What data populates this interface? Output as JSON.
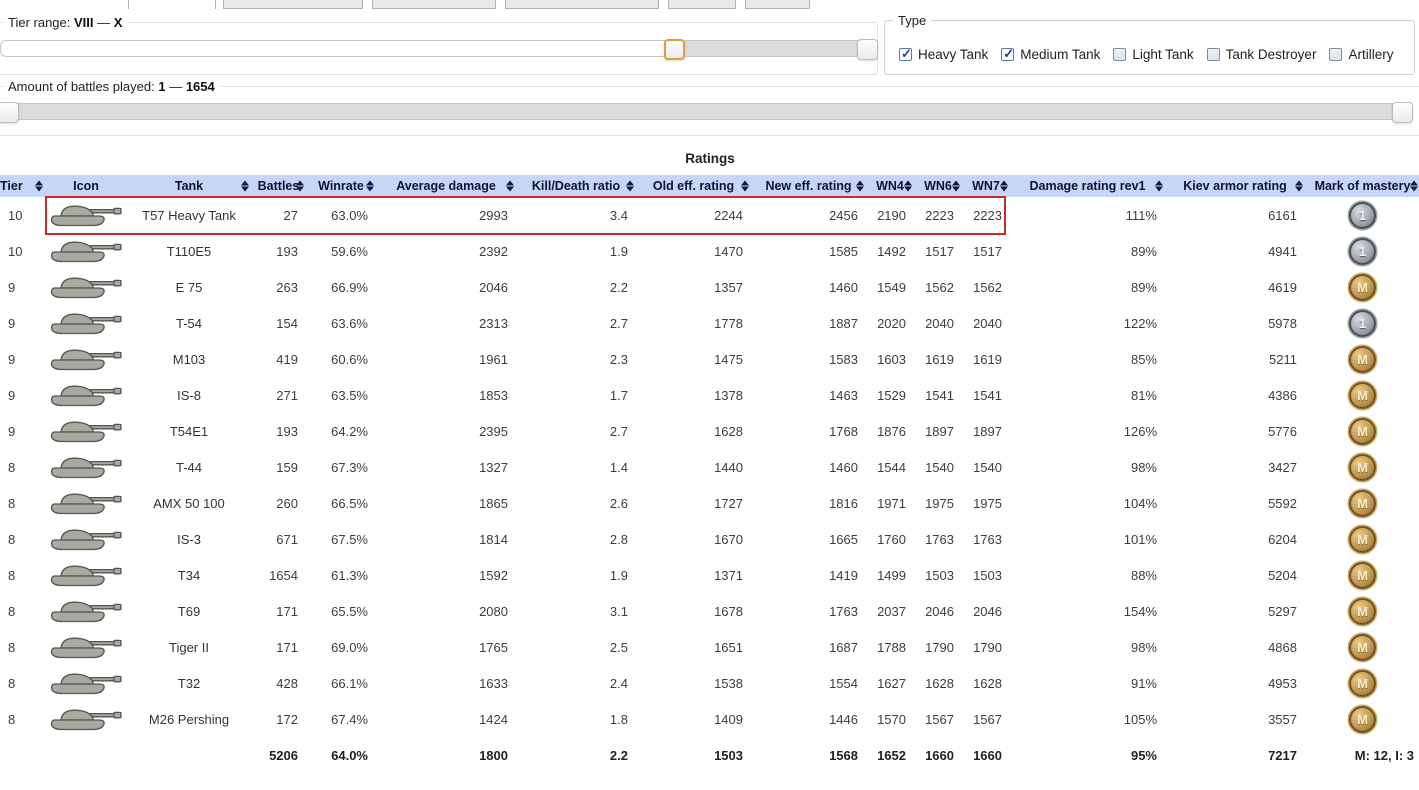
{
  "filters": {
    "tier_range": {
      "label": "Tier range:",
      "from": "VIII",
      "dash": "—",
      "to": "X"
    },
    "battles_range": {
      "label": "Amount of battles played:",
      "from": "1",
      "dash": "—",
      "to": "1654"
    },
    "type": {
      "legend": "Type",
      "options": [
        {
          "label": "Heavy Tank",
          "checked": true
        },
        {
          "label": "Medium Tank",
          "checked": true
        },
        {
          "label": "Light Tank",
          "checked": false
        },
        {
          "label": "Tank Destroyer",
          "checked": false
        },
        {
          "label": "Artillery",
          "checked": false
        }
      ]
    }
  },
  "table": {
    "title": "Ratings",
    "columns": [
      {
        "label": "Tier",
        "sortable": true
      },
      {
        "label": "Icon",
        "sortable": false
      },
      {
        "label": "Tank",
        "sortable": true
      },
      {
        "label": "Battles",
        "sortable": true
      },
      {
        "label": "Winrate",
        "sortable": true
      },
      {
        "label": "Average damage",
        "sortable": true
      },
      {
        "label": "Kill/Death ratio",
        "sortable": true
      },
      {
        "label": "Old eff. rating",
        "sortable": true
      },
      {
        "label": "New eff. rating",
        "sortable": true
      },
      {
        "label": "WN4",
        "sortable": true
      },
      {
        "label": "WN6",
        "sortable": true
      },
      {
        "label": "WN7",
        "sortable": true
      },
      {
        "label": "Damage rating rev1",
        "sortable": true
      },
      {
        "label": "Kiev armor rating",
        "sortable": true
      },
      {
        "label": "Mark of mastery",
        "sortable": true
      }
    ],
    "rows": [
      {
        "tier": "10",
        "tank": "T57 Heavy Tank",
        "battles": "27",
        "winrate": "63.0%",
        "avg_damage": "2993",
        "kd": "3.4",
        "old_eff": "2244",
        "new_eff": "2456",
        "wn4": "2190",
        "wn6": "2223",
        "wn7": "2223",
        "dmg_rev1": "111%",
        "kiev": "6161",
        "mastery": "1",
        "highlighted": true
      },
      {
        "tier": "10",
        "tank": "T110E5",
        "battles": "193",
        "winrate": "59.6%",
        "avg_damage": "2392",
        "kd": "1.9",
        "old_eff": "1470",
        "new_eff": "1585",
        "wn4": "1492",
        "wn6": "1517",
        "wn7": "1517",
        "dmg_rev1": "89%",
        "kiev": "4941",
        "mastery": "1"
      },
      {
        "tier": "9",
        "tank": "E 75",
        "battles": "263",
        "winrate": "66.9%",
        "avg_damage": "2046",
        "kd": "2.2",
        "old_eff": "1357",
        "new_eff": "1460",
        "wn4": "1549",
        "wn6": "1562",
        "wn7": "1562",
        "dmg_rev1": "89%",
        "kiev": "4619",
        "mastery": "M"
      },
      {
        "tier": "9",
        "tank": "T-54",
        "battles": "154",
        "winrate": "63.6%",
        "avg_damage": "2313",
        "kd": "2.7",
        "old_eff": "1778",
        "new_eff": "1887",
        "wn4": "2020",
        "wn6": "2040",
        "wn7": "2040",
        "dmg_rev1": "122%",
        "kiev": "5978",
        "mastery": "1"
      },
      {
        "tier": "9",
        "tank": "M103",
        "battles": "419",
        "winrate": "60.6%",
        "avg_damage": "1961",
        "kd": "2.3",
        "old_eff": "1475",
        "new_eff": "1583",
        "wn4": "1603",
        "wn6": "1619",
        "wn7": "1619",
        "dmg_rev1": "85%",
        "kiev": "5211",
        "mastery": "M"
      },
      {
        "tier": "9",
        "tank": "IS-8",
        "battles": "271",
        "winrate": "63.5%",
        "avg_damage": "1853",
        "kd": "1.7",
        "old_eff": "1378",
        "new_eff": "1463",
        "wn4": "1529",
        "wn6": "1541",
        "wn7": "1541",
        "dmg_rev1": "81%",
        "kiev": "4386",
        "mastery": "M"
      },
      {
        "tier": "9",
        "tank": "T54E1",
        "battles": "193",
        "winrate": "64.2%",
        "avg_damage": "2395",
        "kd": "2.7",
        "old_eff": "1628",
        "new_eff": "1768",
        "wn4": "1876",
        "wn6": "1897",
        "wn7": "1897",
        "dmg_rev1": "126%",
        "kiev": "5776",
        "mastery": "M"
      },
      {
        "tier": "8",
        "tank": "T-44",
        "battles": "159",
        "winrate": "67.3%",
        "avg_damage": "1327",
        "kd": "1.4",
        "old_eff": "1440",
        "new_eff": "1460",
        "wn4": "1544",
        "wn6": "1540",
        "wn7": "1540",
        "dmg_rev1": "98%",
        "kiev": "3427",
        "mastery": "M"
      },
      {
        "tier": "8",
        "tank": "AMX 50 100",
        "battles": "260",
        "winrate": "66.5%",
        "avg_damage": "1865",
        "kd": "2.6",
        "old_eff": "1727",
        "new_eff": "1816",
        "wn4": "1971",
        "wn6": "1975",
        "wn7": "1975",
        "dmg_rev1": "104%",
        "kiev": "5592",
        "mastery": "M"
      },
      {
        "tier": "8",
        "tank": "IS-3",
        "battles": "671",
        "winrate": "67.5%",
        "avg_damage": "1814",
        "kd": "2.8",
        "old_eff": "1670",
        "new_eff": "1665",
        "wn4": "1760",
        "wn6": "1763",
        "wn7": "1763",
        "dmg_rev1": "101%",
        "kiev": "6204",
        "mastery": "M"
      },
      {
        "tier": "8",
        "tank": "T34",
        "battles": "1654",
        "winrate": "61.3%",
        "avg_damage": "1592",
        "kd": "1.9",
        "old_eff": "1371",
        "new_eff": "1419",
        "wn4": "1499",
        "wn6": "1503",
        "wn7": "1503",
        "dmg_rev1": "88%",
        "kiev": "5204",
        "mastery": "M"
      },
      {
        "tier": "8",
        "tank": "T69",
        "battles": "171",
        "winrate": "65.5%",
        "avg_damage": "2080",
        "kd": "3.1",
        "old_eff": "1678",
        "new_eff": "1763",
        "wn4": "2037",
        "wn6": "2046",
        "wn7": "2046",
        "dmg_rev1": "154%",
        "kiev": "5297",
        "mastery": "M"
      },
      {
        "tier": "8",
        "tank": "Tiger II",
        "battles": "171",
        "winrate": "69.0%",
        "avg_damage": "1765",
        "kd": "2.5",
        "old_eff": "1651",
        "new_eff": "1687",
        "wn4": "1788",
        "wn6": "1790",
        "wn7": "1790",
        "dmg_rev1": "98%",
        "kiev": "4868",
        "mastery": "M"
      },
      {
        "tier": "8",
        "tank": "T32",
        "battles": "428",
        "winrate": "66.1%",
        "avg_damage": "1633",
        "kd": "2.4",
        "old_eff": "1538",
        "new_eff": "1554",
        "wn4": "1627",
        "wn6": "1628",
        "wn7": "1628",
        "dmg_rev1": "91%",
        "kiev": "4953",
        "mastery": "M"
      },
      {
        "tier": "8",
        "tank": "M26 Pershing",
        "battles": "172",
        "winrate": "67.4%",
        "avg_damage": "1424",
        "kd": "1.8",
        "old_eff": "1409",
        "new_eff": "1446",
        "wn4": "1570",
        "wn6": "1567",
        "wn7": "1567",
        "dmg_rev1": "105%",
        "kiev": "3557",
        "mastery": "M"
      }
    ],
    "totals": {
      "battles": "5206",
      "winrate": "64.0%",
      "avg_damage": "1800",
      "kd": "2.2",
      "old_eff": "1503",
      "new_eff": "1568",
      "wn4": "1652",
      "wn6": "1660",
      "wn7": "1660",
      "dmg_rev1": "95%",
      "kiev": "7217",
      "mastery_summary": "M: 12, I: 3"
    }
  },
  "colors": {
    "header_bg": "#c7d6f5",
    "highlight_red": "#c22e2e",
    "focus_handle": "#df9e3a",
    "badge_silver": "#a0a4ac",
    "badge_bronze": "#c2954f"
  }
}
